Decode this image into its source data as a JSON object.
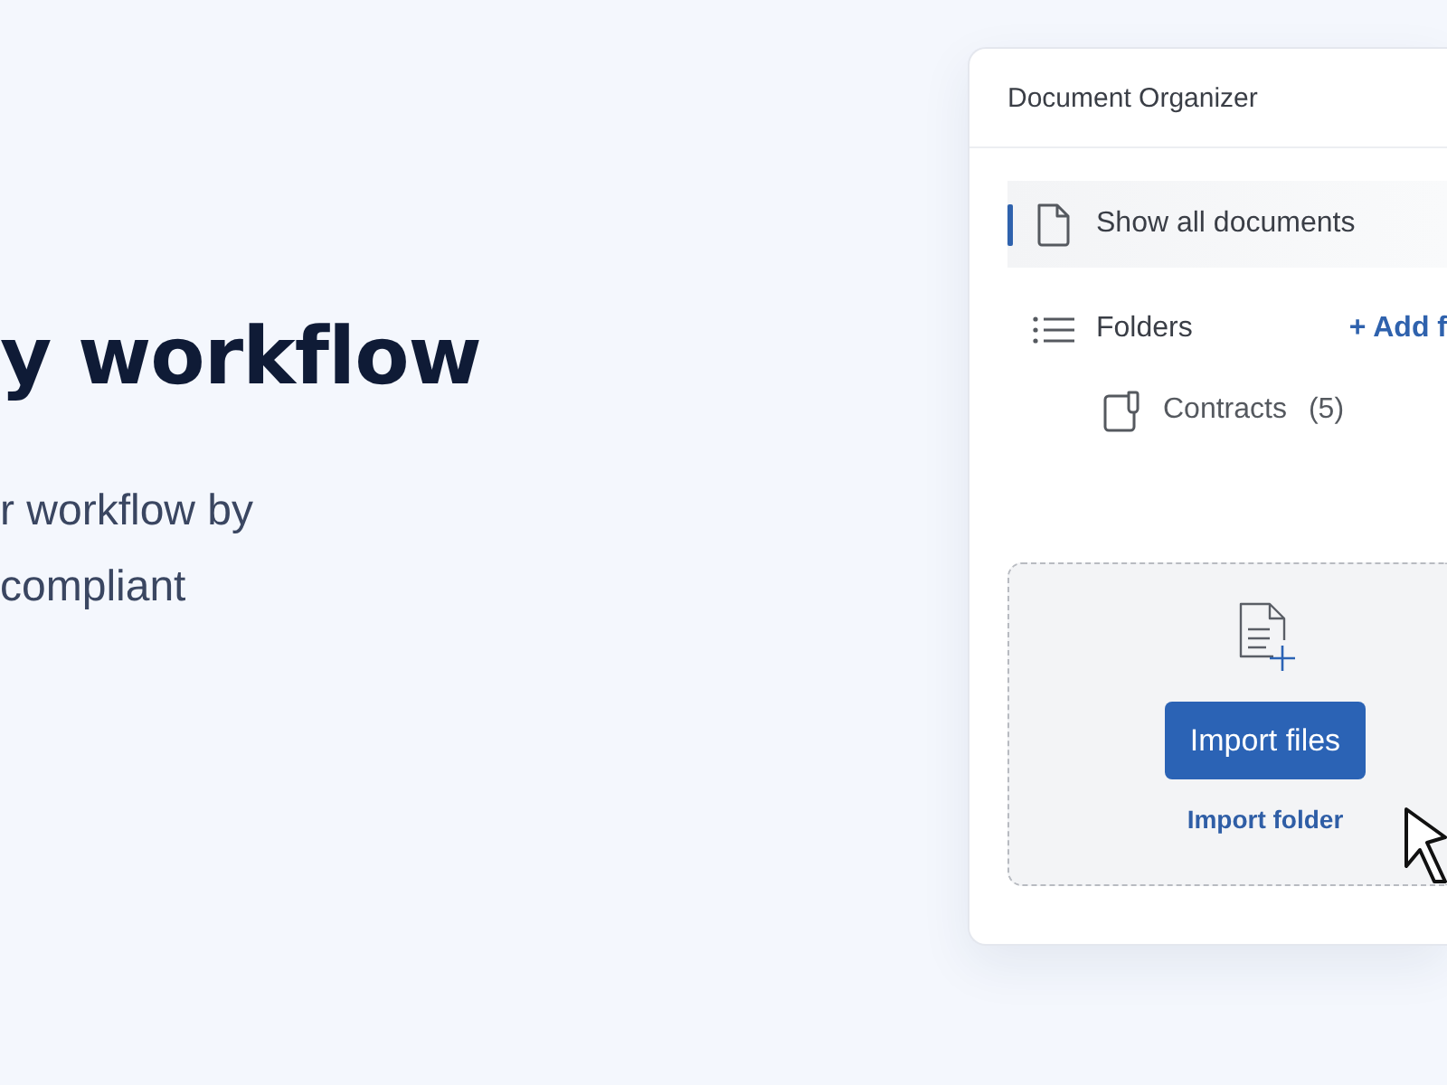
{
  "hero": {
    "heading": "y workflow",
    "description_lines": [
      "r workflow by",
      "compliant"
    ]
  },
  "panel": {
    "title": "Document Organizer",
    "nav": [
      {
        "label": "Show all documents",
        "selected": true
      }
    ],
    "folders": {
      "label": "Folders",
      "add_action": "+ Add f",
      "items": [
        {
          "name": "Contracts",
          "count": "(5)"
        }
      ]
    },
    "dropzone": {
      "button": "Import files",
      "link": "Import folder"
    }
  }
}
